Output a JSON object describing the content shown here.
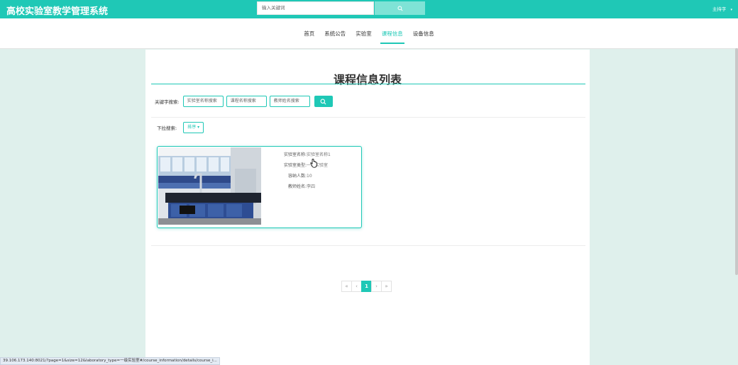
{
  "header": {
    "site_title": "高校实验室教学管理系统",
    "search_placeholder": "输入关键词",
    "user_label": "主持字",
    "user_caret": "▾"
  },
  "nav": {
    "items": [
      {
        "label": "首页",
        "active": false
      },
      {
        "label": "系统公告",
        "active": false
      },
      {
        "label": "实验室",
        "active": false
      },
      {
        "label": "课程信息",
        "active": true
      },
      {
        "label": "设备信息",
        "active": false
      }
    ]
  },
  "main": {
    "title": "课程信息列表",
    "search": {
      "label": "关键字搜索:",
      "inputs": [
        "实验室名称搜索",
        "课程名称搜索",
        "教师姓名搜索"
      ]
    },
    "dropdown": {
      "label": "下拉搜索:",
      "sort_label": "排序 ▾"
    },
    "card": {
      "fields": [
        {
          "label": "实验室名称:",
          "value": "实验室名称1"
        },
        {
          "label": "实验室类型:",
          "value": "一级实验室"
        },
        {
          "label": "容纳人数:",
          "value": "10"
        },
        {
          "label": "教师姓名:",
          "value": "李四"
        }
      ]
    },
    "pagination": {
      "first": "«",
      "prev": "‹",
      "current": "1",
      "next": "›",
      "last": "»"
    }
  },
  "status_bar": {
    "url": "39.106.173.140:8021/?page=1&size=12&laboratory_type=一级实验室#/course_information/details/course_i..."
  },
  "colors": {
    "accent": "#1fc8b6",
    "background": "#dff0ec"
  }
}
